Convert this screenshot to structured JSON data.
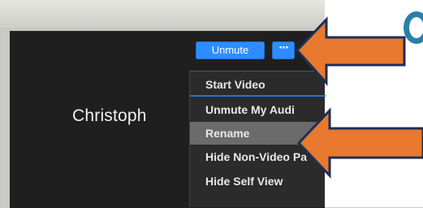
{
  "participant": {
    "name": "Christoph"
  },
  "controls": {
    "unmute_label": "Unmute",
    "more_label": "···"
  },
  "menu": {
    "items": [
      {
        "label": "Start Video"
      },
      {
        "label": "Unmute My Audi"
      },
      {
        "label": "Rename"
      },
      {
        "label": "Hide Non-Video Pa"
      },
      {
        "label": "Hide Self View"
      }
    ],
    "hovered_item": "Rename"
  },
  "annotations": {
    "arrow_color": "#e8792e",
    "arrow_outline": "#1d2f55",
    "accent_blue": "#2d8cff",
    "teal_glyph_color": "#2a7fa8",
    "arrows": [
      {
        "target": "more-button"
      },
      {
        "target": "menu-item-rename"
      }
    ]
  }
}
